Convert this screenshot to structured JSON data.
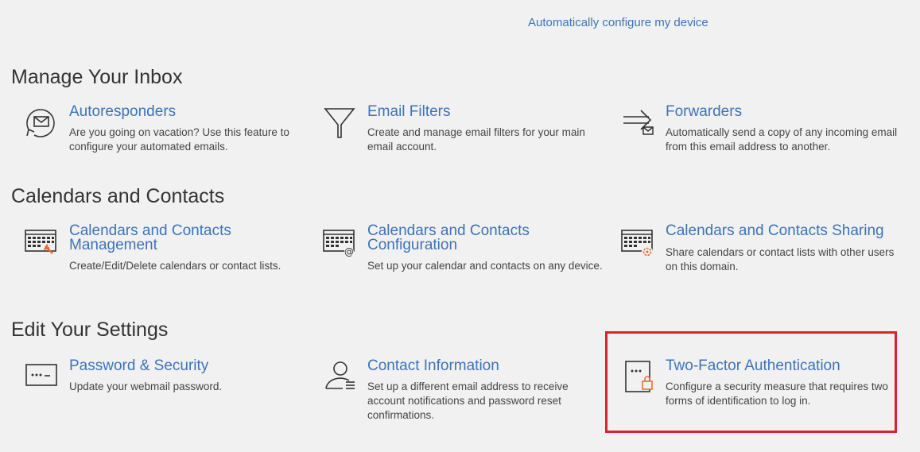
{
  "header": {
    "auto_config_link": "Automatically configure my device"
  },
  "sections": [
    {
      "title": "Manage Your Inbox",
      "items": [
        {
          "title": "Autoresponders",
          "desc": "Are you going on vacation? Use this feature to configure your automated emails.",
          "icon": "autoresponder-icon"
        },
        {
          "title": "Email Filters",
          "desc": "Create and manage email filters for your main email account.",
          "icon": "filter-icon"
        },
        {
          "title": "Forwarders",
          "desc": "Automatically send a copy of any incoming email from this email address to another.",
          "icon": "forwarder-icon"
        }
      ]
    },
    {
      "title": "Calendars and Contacts",
      "items": [
        {
          "title": "Calendars and Contacts Management",
          "desc": "Create/Edit/Delete calendars or contact lists.",
          "icon": "calendar-edit-icon"
        },
        {
          "title": "Calendars and Contacts Configuration",
          "desc": "Set up your calendar and contacts on any device.",
          "icon": "calendar-config-icon"
        },
        {
          "title": "Calendars and Contacts Sharing",
          "desc": "Share calendars or contact lists with other users on this domain.",
          "icon": "calendar-share-icon"
        }
      ]
    },
    {
      "title": "Edit Your Settings",
      "items": [
        {
          "title": "Password & Security",
          "desc": "Update your webmail password.",
          "icon": "password-icon"
        },
        {
          "title": "Contact Information",
          "desc": "Set up a different email address to receive account notifications and password reset confirmations.",
          "icon": "contact-info-icon"
        },
        {
          "title": "Two-Factor Authentication",
          "desc": "Configure a security measure that requires two forms of identification to log in.",
          "icon": "two-factor-icon"
        }
      ]
    }
  ],
  "colors": {
    "link": "#3d73b9",
    "accent": "#e8672c",
    "highlight": "#d9232e"
  }
}
